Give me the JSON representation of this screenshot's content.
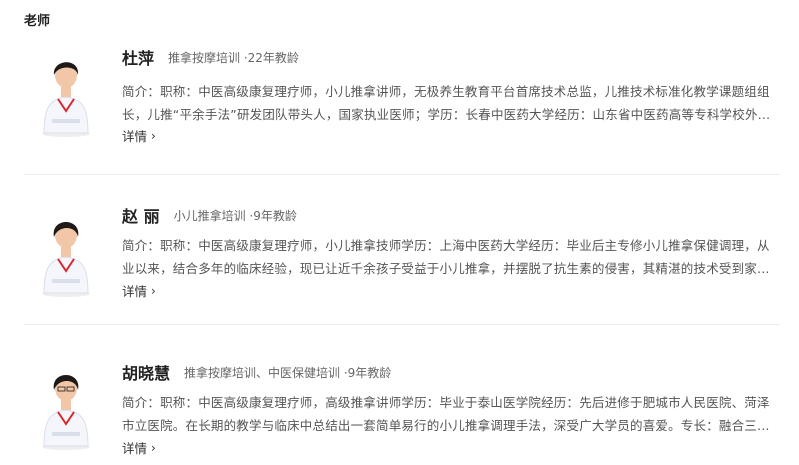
{
  "section": {
    "title": "老师"
  },
  "teachers": [
    {
      "name": "杜萍",
      "meta": "推拿按摩培训 ·22年教龄",
      "bio": "简介：职称：中医高级康复理疗师，小儿推拿讲师，无极养生教育平台首席技术总监，儿推技术标准化教学课题组组长，儿推“平余手法”研发团队带头人，国家执业医师；学历：长春中医药大学经历：山东省中医药高等专科学校外…",
      "detail": "详情",
      "detail_icon": "chevron-right-icon"
    },
    {
      "name": "赵 丽",
      "meta": "小儿推拿培训 ·9年教龄",
      "bio": "简介：职称：中医高级康复理疗师，小儿推拿技师学历：上海中医药大学经历：毕业后主专修小儿推拿保健调理，从业以来，结合多年的临床经验，现已让近千余孩子受益于小儿推拿，并摆脱了抗生素的侵害，其精湛的技术受到家长…",
      "detail": "详情",
      "detail_icon": "chevron-right-icon"
    },
    {
      "name": "胡晓慧",
      "meta": "推拿按摩培训、中医保健培训 ·9年教龄",
      "bio": "简介：职称：中医高级康复理疗师，高级推拿讲师学历：毕业于泰山医学院经历：先后进修于肥城市人民医院、菏泽市立医院。在长期的教学与临床中总结出一套简单易行的小儿推拿调理手法，深受广大学员的喜爱。专长：融合三字…",
      "detail": "详情",
      "detail_icon": "chevron-right-icon"
    }
  ],
  "colors": {
    "uniform": "#f4f6fb",
    "uniform_shadow": "#d9deea",
    "hair": "#1f1a18",
    "skin": "#f1c7a8",
    "collar": "#d9262d"
  }
}
